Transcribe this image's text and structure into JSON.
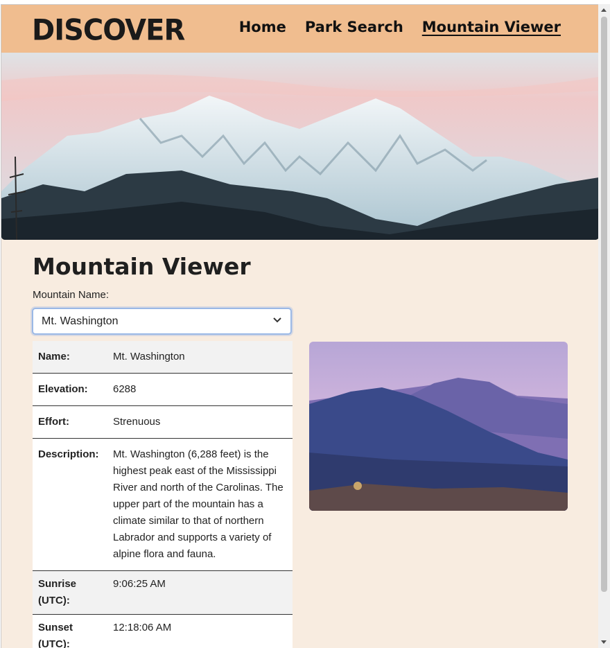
{
  "brand": "DISCOVER",
  "nav": {
    "home": "Home",
    "park_search": "Park Search",
    "mountain_viewer": "Mountain Viewer",
    "active": "Mountain Viewer"
  },
  "page": {
    "title": "Mountain Viewer",
    "select_label": "Mountain Name:",
    "selected_mountain": "Mt. Washington"
  },
  "details": {
    "name_label": "Name:",
    "name": "Mt. Washington",
    "elevation_label": "Elevation:",
    "elevation": "6288",
    "effort_label": "Effort:",
    "effort": "Strenuous",
    "description_label": "Description:",
    "description": "Mt. Washington (6,288 feet) is the highest peak east of the Mississippi River and north of the Carolinas. The upper part of the mountain has a climate similar to that of northern Labrador and supports a variety of alpine flora and fauna.",
    "sunrise_label": "Sunrise (UTC):",
    "sunrise": "9:06:25 AM",
    "sunset_label": "Sunset (UTC):",
    "sunset": "12:18:06 AM"
  },
  "colors": {
    "nav_bg": "#f0bd8f",
    "page_bg": "#f8ece0",
    "select_border": "#9ab8e6"
  },
  "icons": {
    "select": "chevron-down-icon"
  }
}
